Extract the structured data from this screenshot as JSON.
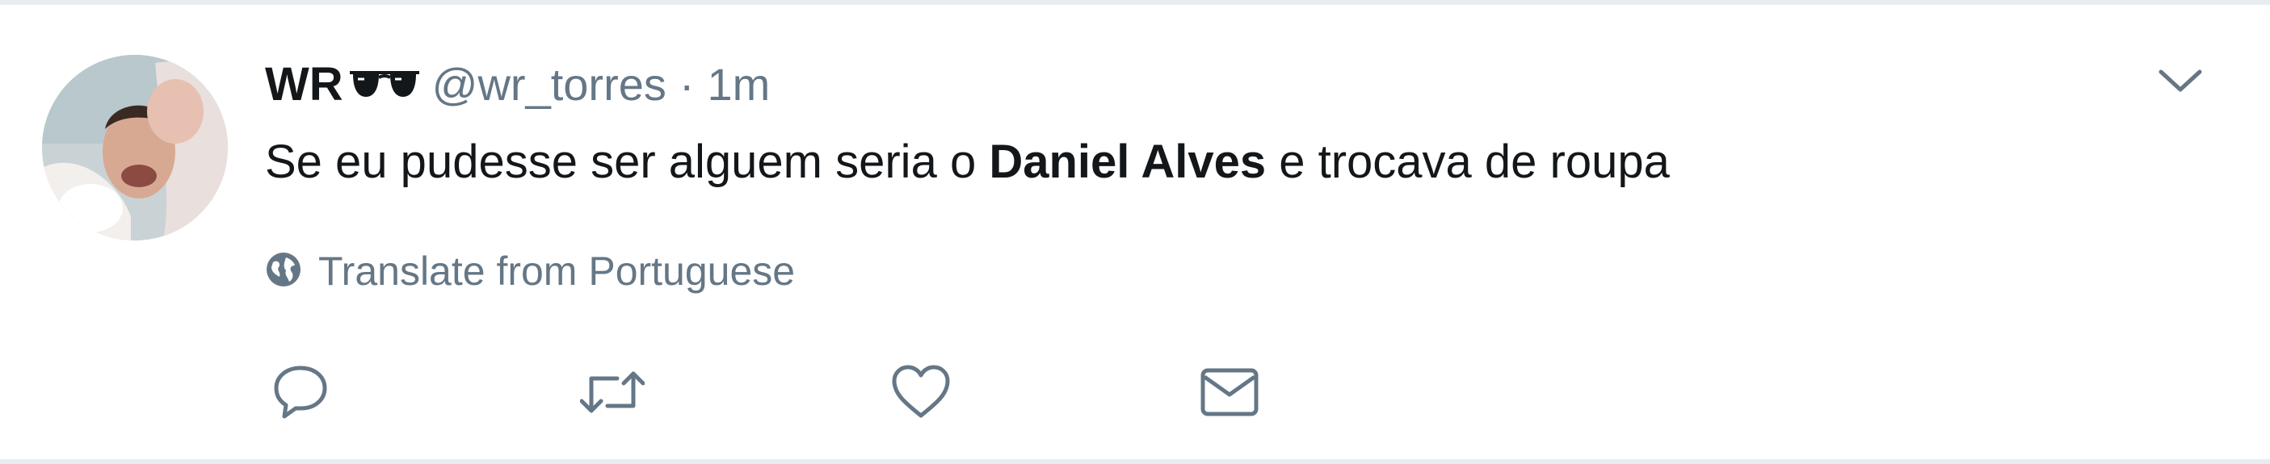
{
  "tweet": {
    "author": {
      "display_name": "WR",
      "name_emoji": "sunglasses-emoji",
      "handle": "@wr_torres"
    },
    "separator": "·",
    "time": "1m",
    "text": {
      "before": "Se eu pudesse ser alguem seria o ",
      "bold": "Daniel Alves",
      "after": " e trocava de roupa"
    },
    "translate_label": "Translate from Portuguese",
    "actions": [
      {
        "name": "reply",
        "icon": "speech-bubble-icon"
      },
      {
        "name": "retweet",
        "icon": "retweet-arrows-icon"
      },
      {
        "name": "like",
        "icon": "heart-icon"
      },
      {
        "name": "direct-message",
        "icon": "envelope-icon"
      }
    ],
    "menu_icon": "chevron-down-icon"
  },
  "colors": {
    "text_primary": "#14171a",
    "text_secondary": "#657786",
    "border": "#e6ecf0"
  }
}
